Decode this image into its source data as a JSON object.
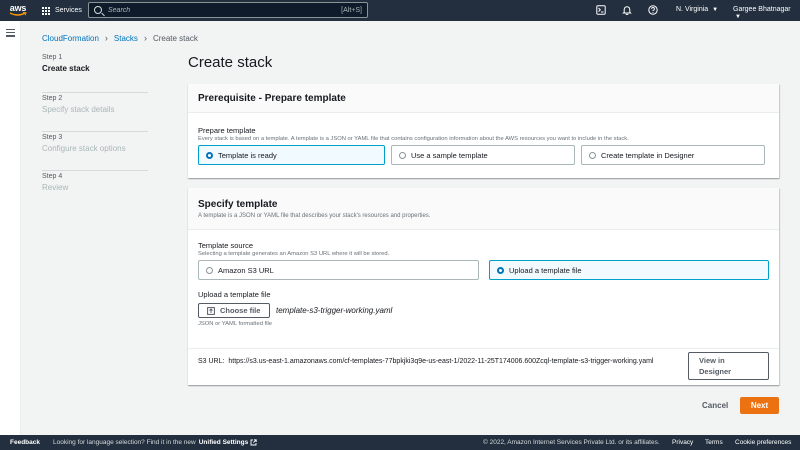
{
  "topnav": {
    "logo_text": "aws",
    "services_label": "Services",
    "search_placeholder": "Search",
    "search_shortcut": "[Alt+S]",
    "region": "N. Virginia",
    "user": "Gargee Bhatnagar"
  },
  "breadcrumb": {
    "items": [
      "CloudFormation",
      "Stacks"
    ],
    "current": "Create stack"
  },
  "steps": [
    {
      "num": "Step 1",
      "label": "Create stack"
    },
    {
      "num": "Step 2",
      "label": "Specify stack details"
    },
    {
      "num": "Step 3",
      "label": "Configure stack options"
    },
    {
      "num": "Step 4",
      "label": "Review"
    }
  ],
  "page_title": "Create stack",
  "prerequisite": {
    "title": "Prerequisite - Prepare template",
    "field_label": "Prepare template",
    "field_desc": "Every stack is based on a template. A template is a JSON or YAML file that contains configuration information about the AWS resources you want to include in the stack.",
    "options": [
      "Template is ready",
      "Use a sample template",
      "Create template in Designer"
    ]
  },
  "specify": {
    "title": "Specify template",
    "desc": "A template is a JSON or YAML file that describes your stack's resources and properties.",
    "source_label": "Template source",
    "source_desc": "Selecting a template generates an Amazon S3 URL where it will be stored.",
    "source_options": [
      "Amazon S3 URL",
      "Upload a template file"
    ],
    "upload_label": "Upload a template file",
    "choose_button": "Choose file",
    "file_name": "template-s3-trigger-working.yaml",
    "file_hint": "JSON or YAML formatted file",
    "s3_label": "S3 URL:",
    "s3_url": "https://s3.us-east-1.amazonaws.com/cf-templates-77bpkjki3q9e-us-east-1/2022-11-25T174006.600Zcql-template-s3-trigger-working.yaml",
    "view_button": "View in Designer"
  },
  "actions": {
    "cancel": "Cancel",
    "next": "Next"
  },
  "footer": {
    "feedback": "Feedback",
    "language_text": "Looking for language selection? Find it in the new",
    "unified_settings": "Unified Settings",
    "copyright": "© 2022, Amazon Internet Services Private Ltd. or its affiliates.",
    "privacy": "Privacy",
    "terms": "Terms",
    "cookies": "Cookie preferences"
  },
  "colors": {
    "nav_bg": "#232f3e",
    "link": "#0073bb",
    "primary": "#ec7211",
    "selected_border": "#00a1c9"
  }
}
